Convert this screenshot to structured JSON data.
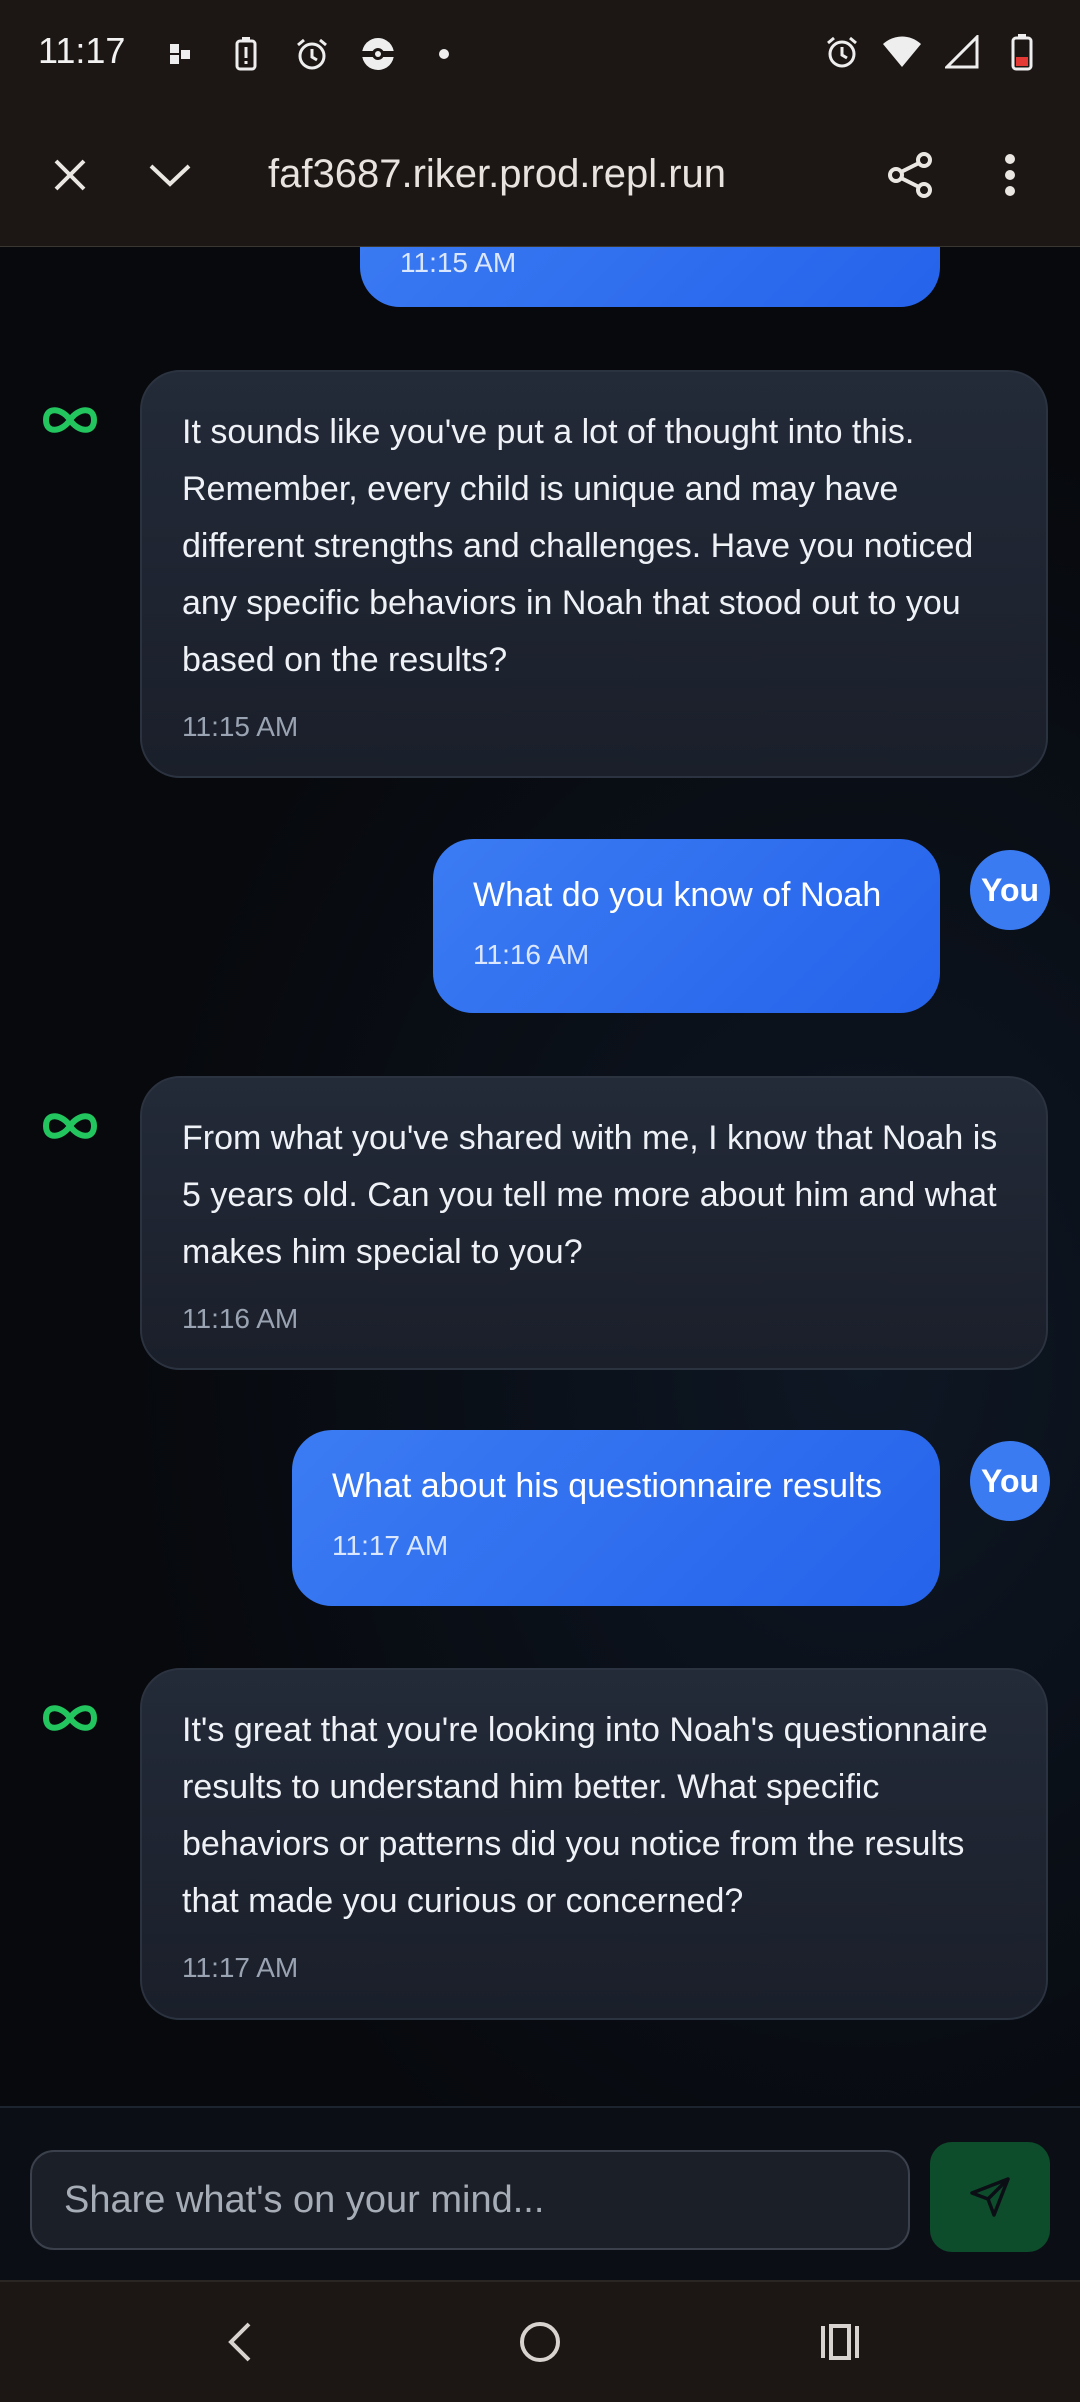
{
  "status_bar": {
    "time": "11:17"
  },
  "browser": {
    "url": "faf3687.riker.prod.repl.run",
    "icons": [
      "close-icon",
      "chevron-down-icon",
      "share-icon",
      "more-vert-icon"
    ]
  },
  "chat": {
    "partial_message": {
      "time": "11:15 AM"
    },
    "messages": [
      {
        "role": "assistant",
        "text": "It sounds like you've put a lot of thought into this. Remember, every child is unique and may have different strengths and challenges. Have you noticed any specific behaviors in Noah that stood out to you based on the results?",
        "time": "11:15 AM"
      },
      {
        "role": "user",
        "avatar": "You",
        "text": "What do you know of Noah",
        "time": "11:16 AM"
      },
      {
        "role": "assistant",
        "text": "From what you've shared with me, I know that Noah is 5 years old. Can you tell me more about him and what makes him special to you?",
        "time": "11:16 AM"
      },
      {
        "role": "user",
        "avatar": "You",
        "text": "What about his questionnaire results",
        "time": "11:17 AM"
      },
      {
        "role": "assistant",
        "text": "It's great that you're looking into Noah's questionnaire results to understand him better. What specific behaviors or patterns did you notice from the results that made you curious or concerned?",
        "time": "11:17 AM"
      }
    ]
  },
  "composer": {
    "placeholder": "Share what's on your mind...",
    "value": ""
  },
  "colors": {
    "user_bubble": "#2563eb",
    "ai_icon": "#22c55e",
    "send_button": "#0d4d2c"
  }
}
